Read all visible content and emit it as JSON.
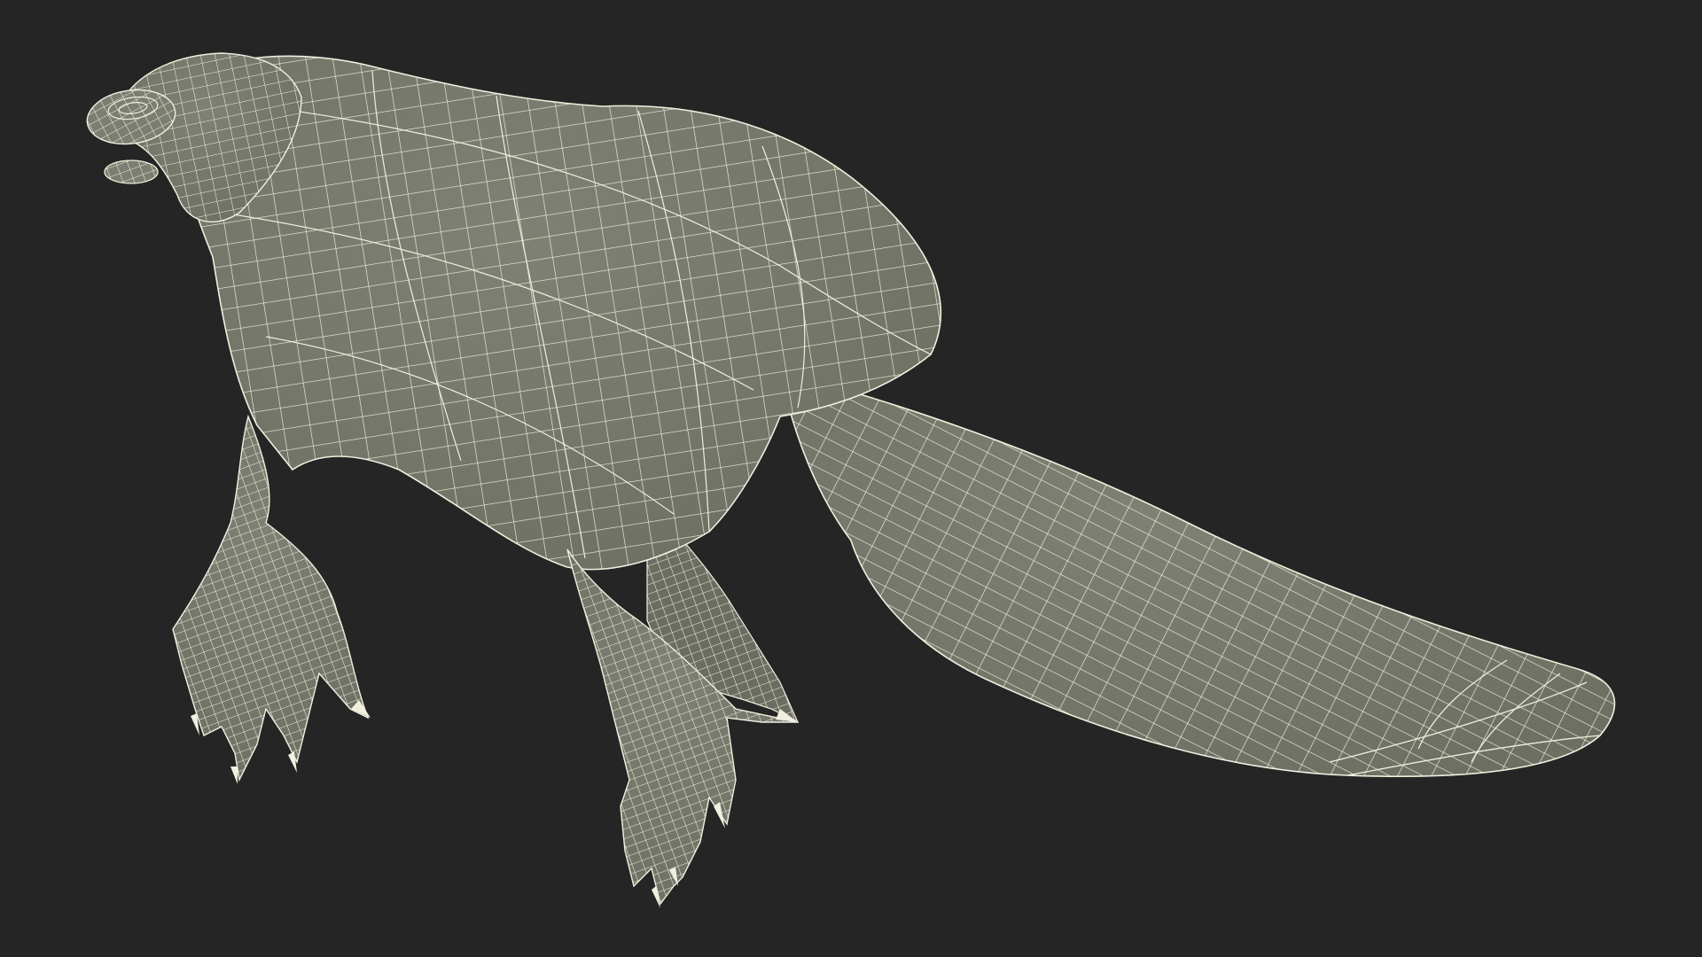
{
  "scene": {
    "subject": "platypus-wireframe-model",
    "colors": {
      "background": "#252525",
      "surface": "#777a6c",
      "surface_dark": "#5f6256",
      "wire": "#f1efdf"
    }
  }
}
